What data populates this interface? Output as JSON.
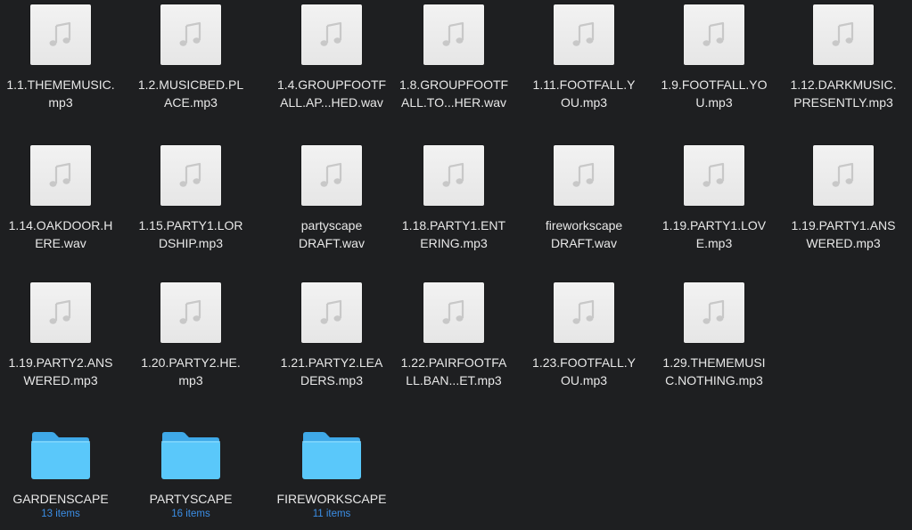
{
  "files": [
    {
      "line1": "1.1.THEMEMUSIC.",
      "line2": "mp3",
      "icon": "music-note-icon"
    },
    {
      "line1": "1.2.MUSICBED.PL",
      "line2": "ACE.mp3",
      "icon": "music-note-icon"
    },
    {
      "line1": "1.4.GROUPFOOTF",
      "line2": "ALL.AP...HED.wav",
      "icon": "music-note-icon"
    },
    {
      "line1": "1.8.GROUPFOOTF",
      "line2": "ALL.TO...HER.wav",
      "icon": "music-note-icon"
    },
    {
      "line1": "1.11.FOOTFALL.Y",
      "line2": "OU.mp3",
      "icon": "music-note-icon"
    },
    {
      "line1": "1.9.FOOTFALL.YO",
      "line2": "U.mp3",
      "icon": "music-note-icon"
    },
    {
      "line1": "1.12.DARKMUSIC.",
      "line2": "PRESENTLY.mp3",
      "icon": "music-note-icon"
    },
    {
      "line1": "1.14.OAKDOOR.H",
      "line2": "ERE.wav",
      "icon": "music-note-icon"
    },
    {
      "line1": "1.15.PARTY1.LOR",
      "line2": "DSHIP.mp3",
      "icon": "music-note-icon"
    },
    {
      "line1": "partyscape",
      "line2": "DRAFT.wav",
      "icon": "music-note-icon"
    },
    {
      "line1": "1.18.PARTY1.ENT",
      "line2": "ERING.mp3",
      "icon": "music-note-icon"
    },
    {
      "line1": "fireworkscape",
      "line2": "DRAFT.wav",
      "icon": "music-note-icon"
    },
    {
      "line1": "1.19.PARTY1.LOV",
      "line2": "E.mp3",
      "icon": "music-note-icon"
    },
    {
      "line1": "1.19.PARTY1.ANS",
      "line2": "WERED.mp3",
      "icon": "music-note-icon"
    },
    {
      "line1": "1.19.PARTY2.ANS",
      "line2": "WERED.mp3",
      "icon": "music-note-icon"
    },
    {
      "line1": "1.20.PARTY2.HE.",
      "line2": "mp3",
      "icon": "music-note-icon"
    },
    {
      "line1": "1.21.PARTY2.LEA",
      "line2": "DERS.mp3",
      "icon": "music-note-icon"
    },
    {
      "line1": "1.22.PAIRFOOTFA",
      "line2": "LL.BAN...ET.mp3",
      "icon": "music-note-icon"
    },
    {
      "line1": "1.23.FOOTFALL.Y",
      "line2": "OU.mp3",
      "icon": "music-note-icon"
    },
    {
      "line1": "1.29.THEMEMUSI",
      "line2": "C.NOTHING.mp3",
      "icon": "music-note-icon"
    }
  ],
  "folders": [
    {
      "name": "GARDENSCAPE",
      "count": "13 items",
      "icon": "folder-icon"
    },
    {
      "name": "PARTYSCAPE",
      "count": "16 items",
      "icon": "folder-icon"
    },
    {
      "name": "FIREWORKSCAPE",
      "count": "11 items",
      "icon": "folder-icon"
    }
  ],
  "colors": {
    "background": "#1e1f21",
    "text": "#e8e8e8",
    "count": "#3b8ee6",
    "folder_front": "#5ac8fa",
    "folder_back": "#3fa9e8",
    "note": "#c8c8c8"
  }
}
